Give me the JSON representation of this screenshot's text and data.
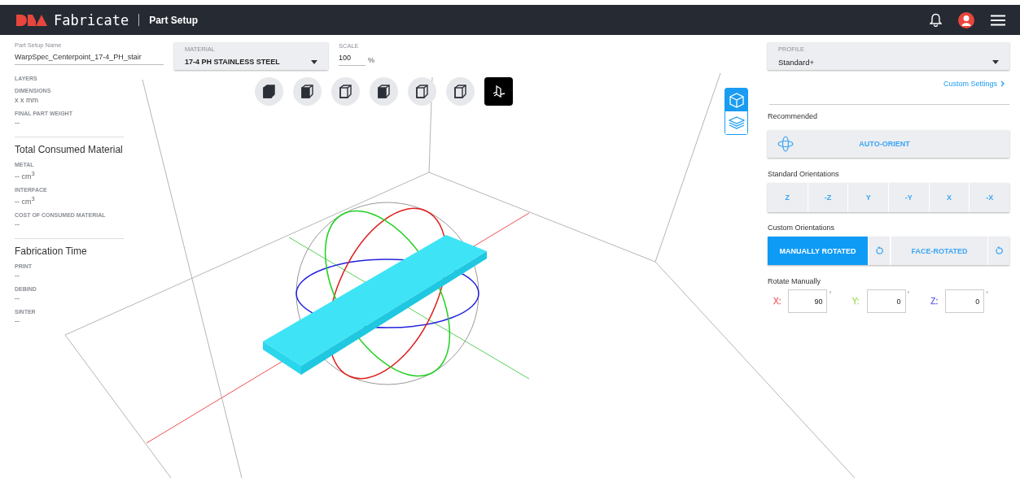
{
  "header": {
    "brand": "Fabricate",
    "page_title": "Part Setup"
  },
  "part_setup_name": {
    "label": "Part Setup Name",
    "value": "WarpSpec_Centerpoint_17-4_PH_stair"
  },
  "material": {
    "label": "MATERIAL",
    "value": "17-4 PH STAINLESS STEEL"
  },
  "scale": {
    "label": "SCALE",
    "value": "100",
    "unit": "%"
  },
  "stats": [
    {
      "items": [
        {
          "label": "LAYERS"
        },
        {
          "label": "DIMENSIONS",
          "value": "x x mm"
        },
        {
          "label": "FINAL PART WEIGHT",
          "value": "--"
        }
      ]
    },
    {
      "heading": "Total Consumed Material",
      "items": [
        {
          "label": "METAL",
          "value": "-- cm$^{3}$"
        },
        {
          "label": "INTERFACE",
          "value": "-- cm$^{3}$"
        },
        {
          "label": "COST OF CONSUMED MATERIAL",
          "value": "--"
        }
      ]
    },
    {
      "heading": "Fabrication Time",
      "items": [
        {
          "label": "PRINT",
          "value": "--"
        },
        {
          "label": "DEBIND",
          "value": "--"
        },
        {
          "label": "SINTER",
          "value": "--"
        }
      ]
    }
  ],
  "view_buttons": [
    {
      "selected": false
    },
    {
      "selected": false
    },
    {
      "selected": false
    },
    {
      "selected": false
    },
    {
      "selected": false
    },
    {
      "selected": false
    },
    {
      "selected": true
    }
  ],
  "view_mode_toggle": [
    {
      "kind": "model",
      "selected": true
    },
    {
      "kind": "layers",
      "selected": false
    }
  ],
  "profile": {
    "label": "PROFILE",
    "value": "Standard+"
  },
  "custom_settings_link": "Custom Settings",
  "recommended": {
    "heading": "Recommended",
    "button": "AUTO-ORIENT"
  },
  "standard_orientations": {
    "heading": "Standard Orientations",
    "buttons": [
      "Z",
      "-Z",
      "Y",
      "-Y",
      "X",
      "-X"
    ]
  },
  "custom_orientations": {
    "heading": "Custom Orientations",
    "options": [
      {
        "label": "MANUALLY ROTATED",
        "selected": true
      },
      {
        "label": "FACE-ROTATED",
        "selected": false
      }
    ]
  },
  "rotate_manually": {
    "heading": "Rotate Manually",
    "fields": [
      {
        "label": "X:",
        "color": "#f26b6b",
        "value": "90",
        "unit": "°"
      },
      {
        "label": "Y:",
        "color": "#a8e06a",
        "value": "0",
        "unit": "°"
      },
      {
        "label": "Z:",
        "color": "#6b6bf2",
        "value": "0",
        "unit": "°"
      }
    ]
  }
}
